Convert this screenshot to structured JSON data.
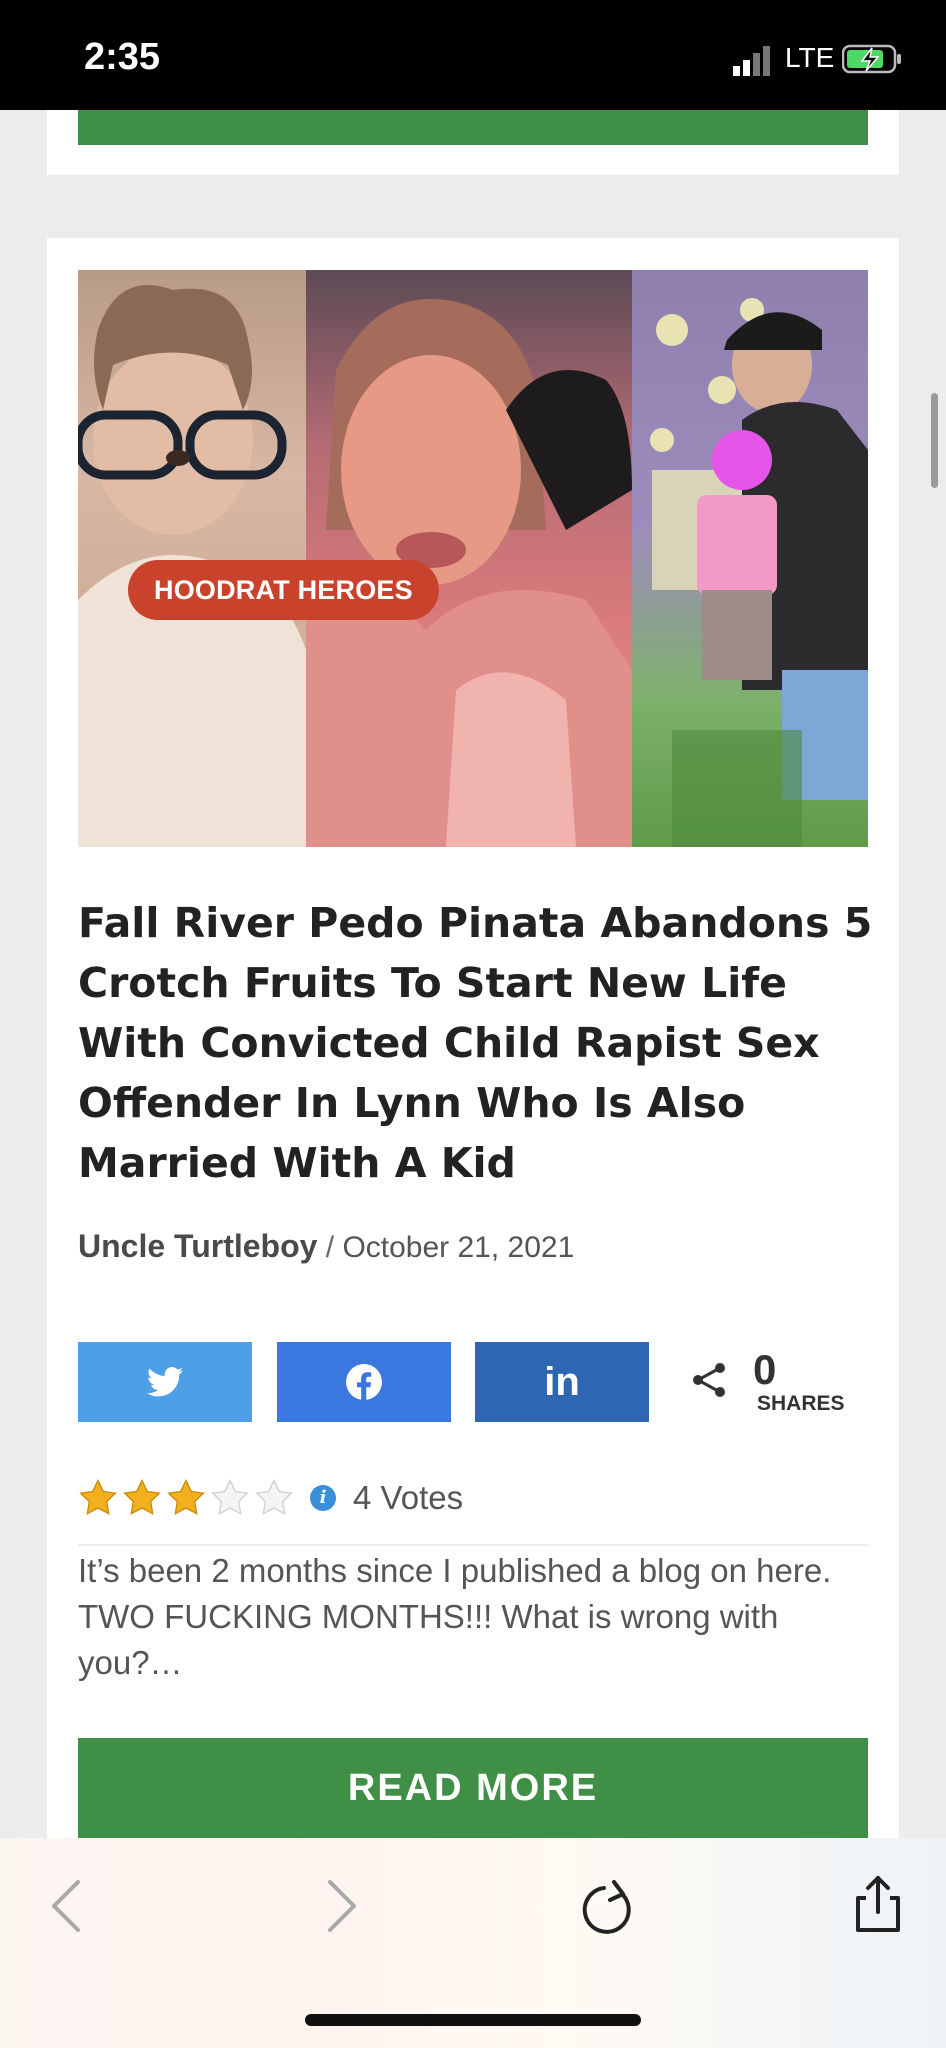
{
  "status_bar": {
    "time": "2:35",
    "carrier": "LTE"
  },
  "article": {
    "category": "HOODRAT HEROES",
    "title": "Fall River Pedo Pinata Abandons 5 Crotch Fruits To Start New Life With Convicted Child Rapist Sex Offender In Lynn Who Is Also Married With A Kid",
    "author": "Uncle Turtleboy",
    "separator": " / ",
    "date": "October 21, 2021",
    "share": {
      "linkedin_label": "in",
      "count": "0",
      "count_label": "SHARES"
    },
    "rating": {
      "stars_filled": 3,
      "stars_total": 5,
      "votes_text": "4 Votes"
    },
    "excerpt": " It’s been 2 months since I published a blog on here. TWO FUCKING MONTHS!!! What is wrong with you?…",
    "read_more_label": "READ MORE"
  },
  "colors": {
    "green": "#3f8f47",
    "tag_red": "#c9422b",
    "twitter": "#4d9fe8",
    "facebook": "#3a78e0",
    "linkedin": "#2f66b2",
    "star": "#f2b01e"
  },
  "icons": [
    "signal-icon",
    "battery-icon",
    "twitter-icon",
    "facebook-icon",
    "share-icon",
    "star-icon",
    "info-icon",
    "back-icon",
    "forward-icon",
    "reload-icon",
    "share-sheet-icon"
  ]
}
